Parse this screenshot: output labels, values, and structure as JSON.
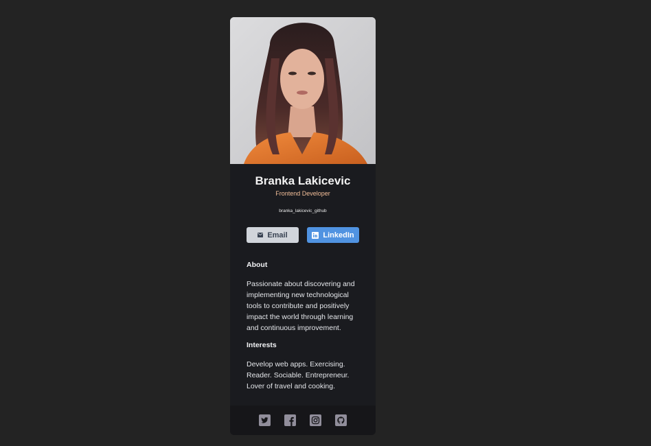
{
  "profile": {
    "name": "Branka Lakicevic",
    "role": "Frontend Developer",
    "handle": "branka_lakicevic_github",
    "photo_alt": "profile photo"
  },
  "buttons": {
    "email_label": "Email",
    "linkedin_label": "LinkedIn"
  },
  "about": {
    "heading": "About",
    "text": "Passionate about discovering and implementing new technological tools to contribute and positively impact the world through learning and continuous improvement."
  },
  "interests": {
    "heading": "Interests",
    "text": "Develop web apps. Exercising. Reader. Sociable. Entrepreneur. Lover of travel and cooking."
  },
  "footer": {
    "icons": [
      "twitter-icon",
      "facebook-icon",
      "instagram-icon",
      "github-icon"
    ]
  },
  "colors": {
    "page_background": "#232323",
    "card_background": "#1a1b1f",
    "footer_background": "#161619",
    "role_color": "#f3bf99",
    "linkedin_blue": "#5093e1",
    "email_gray": "#d1d5db",
    "icon_gray": "#918e9b"
  }
}
